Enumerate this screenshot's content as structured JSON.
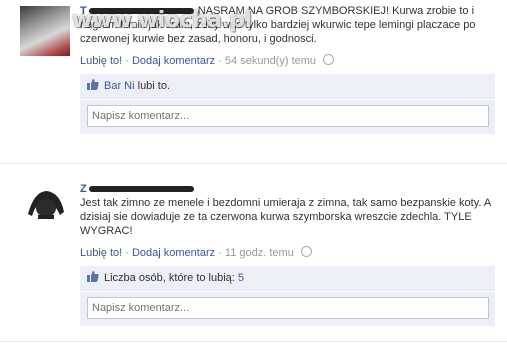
{
  "watermark": "www.wiocha.pl",
  "posts": [
    {
      "author_fragment": "T",
      "text": "NASRAM NA GROB SZYMBORSKIEJ! Kurwa zrobie to i nagram filmik jak sram, zeby was tylko bardziej wkurwic tepe lemingi placzace po czerwonej kurwie bez zasad, honoru, i godnosci.",
      "like_label": "Lubię to!",
      "comment_label": "Dodaj komentarz",
      "time": "54 sekund(y) temu",
      "likes_text": "lubi to.",
      "likes_name": "Bar Ni",
      "comment_placeholder": "Napisz komentarz..."
    },
    {
      "author_fragment": "Z",
      "text": "Jest tak zimno ze menele i bezdomni umieraja z zimna, tak samo bezpanskie koty. A dzisiaj sie dowiaduje ze ta czerwona kurwa szymborska wreszcie zdechla. TYLE WYGRAC!",
      "like_label": "Lubię to!",
      "comment_label": "Dodaj komentarz",
      "time": "11 godz. temu",
      "likes_text": "Liczba osób, które to lubią:",
      "likes_count": "5",
      "comment_placeholder": "Napisz komentarz..."
    }
  ],
  "colors": {
    "link": "#3b5998",
    "meta": "#999999",
    "box_bg": "#eceff5"
  }
}
